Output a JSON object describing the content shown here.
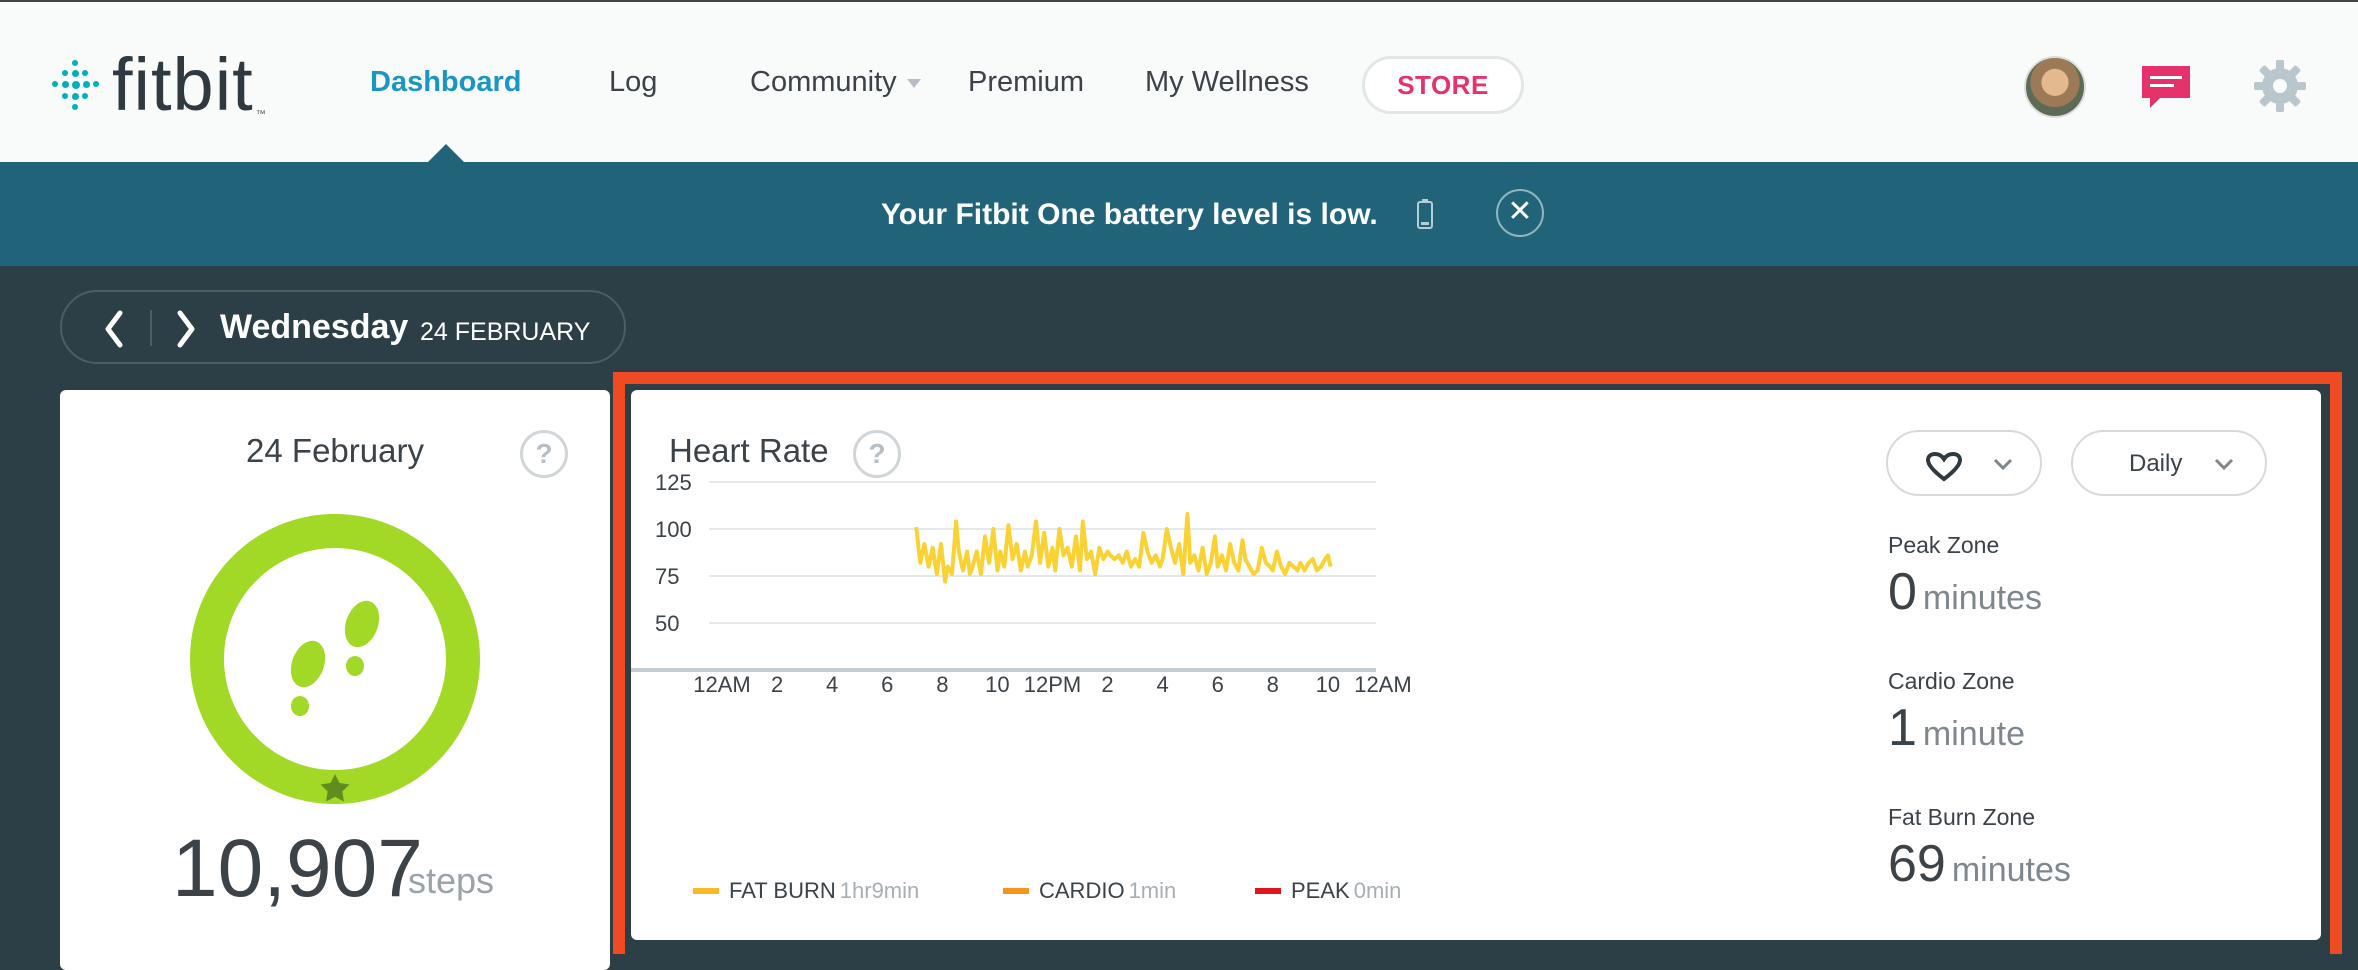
{
  "nav": {
    "logo_text": "fitbit",
    "items": [
      "Dashboard",
      "Log",
      "Community",
      "Premium",
      "My Wellness"
    ],
    "store_label": "STORE"
  },
  "banner": {
    "message": "Your Fitbit One battery level is low.",
    "close_glyph": "✕"
  },
  "date": {
    "day": "Wednesday",
    "full": "24 FEBRUARY"
  },
  "steps_tile": {
    "date": "24 February",
    "help": "?",
    "value": "10,907",
    "unit": "steps",
    "goal_progress": 1.0
  },
  "heart_tile": {
    "title": "Heart Rate",
    "help": "?",
    "period": "Daily",
    "zones": [
      {
        "label": "Peak Zone",
        "value": "0",
        "unit": "minutes"
      },
      {
        "label": "Cardio Zone",
        "value": "1",
        "unit": "minute"
      },
      {
        "label": "Fat Burn Zone",
        "value": "69",
        "unit": "minutes"
      }
    ],
    "legend": [
      {
        "label": "FAT BURN",
        "duration": "1hr9min",
        "color": "#fbb725"
      },
      {
        "label": "CARDIO",
        "duration": "1min",
        "color": "#f7941d"
      },
      {
        "label": "PEAK",
        "duration": "0min",
        "color": "#e3141e"
      }
    ]
  },
  "chart_data": {
    "type": "line",
    "y_ticks": [
      "125",
      "100",
      "75",
      "50"
    ],
    "x_ticks": [
      "12AM",
      "2",
      "4",
      "6",
      "8",
      "10",
      "12PM",
      "2",
      "4",
      "6",
      "8",
      "10",
      "12AM"
    ],
    "ylim": [
      30,
      130
    ],
    "xlim": [
      0,
      24
    ],
    "grid": true,
    "series": [
      {
        "color": "#fbd234",
        "x": [
          7.05,
          7.2,
          7.35,
          7.5,
          7.65,
          7.8,
          7.95,
          8.1,
          8.2,
          8.35,
          8.5,
          8.6,
          8.75,
          8.9,
          9.0,
          9.1,
          9.25,
          9.4,
          9.55,
          9.7,
          9.85,
          10.0,
          10.1,
          10.25,
          10.4,
          10.55,
          10.7,
          10.85,
          11.0,
          11.1,
          11.25,
          11.4,
          11.55,
          11.7,
          11.85,
          12.0,
          12.1,
          12.25,
          12.4,
          12.55,
          12.7,
          12.85,
          13.0,
          13.1,
          13.25,
          13.4,
          13.55,
          13.7,
          13.85,
          14.0,
          14.1,
          14.25,
          14.4,
          14.55,
          14.7,
          14.85,
          15.0,
          15.15,
          15.3,
          15.45,
          15.6,
          15.75,
          15.9,
          16.0,
          16.15,
          16.3,
          16.45,
          16.6,
          16.75,
          16.9,
          17.0,
          17.15,
          17.3,
          17.45,
          17.6,
          17.75,
          17.9,
          18.0,
          18.15,
          18.3,
          18.45,
          18.6,
          18.75,
          18.9,
          19.0,
          19.15,
          19.3,
          19.45,
          19.6,
          19.75,
          19.9,
          20.0,
          20.15,
          20.3,
          20.45,
          20.6,
          20.75,
          20.9,
          21.0,
          21.15,
          21.3,
          21.45,
          21.6,
          21.75,
          21.9,
          22.0,
          22.1
        ],
        "y": [
          101,
          82,
          92,
          80,
          90,
          76,
          92,
          72,
          80,
          76,
          104,
          88,
          78,
          88,
          76,
          80,
          88,
          76,
          96,
          82,
          100,
          78,
          88,
          80,
          102,
          84,
          92,
          78,
          88,
          80,
          86,
          104,
          82,
          98,
          80,
          90,
          78,
          100,
          86,
          90,
          80,
          96,
          78,
          104,
          84,
          88,
          76,
          90,
          84,
          88,
          86,
          84,
          86,
          82,
          88,
          80,
          84,
          80,
          98,
          88,
          82,
          86,
          80,
          84,
          100,
          90,
          82,
          92,
          76,
          108,
          82,
          86,
          78,
          90,
          76,
          82,
          96,
          80,
          86,
          78,
          92,
          82,
          78,
          94,
          84,
          80,
          76,
          78,
          90,
          82,
          80,
          78,
          88,
          80,
          76,
          82,
          80,
          78,
          82,
          78,
          82,
          84,
          78,
          80,
          84,
          86,
          80
        ]
      }
    ]
  }
}
